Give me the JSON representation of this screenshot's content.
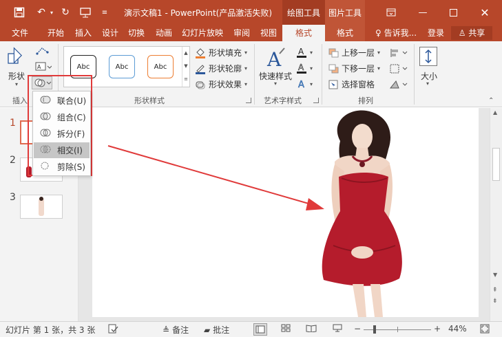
{
  "titlebar": {
    "title": "演示文稿1 - PowerPoint(产品激活失败)",
    "context_drawing": "绘图工具",
    "context_picture": "图片工具"
  },
  "tabs": [
    {
      "label": "文件"
    },
    {
      "label": "开始"
    },
    {
      "label": "插入"
    },
    {
      "label": "设计"
    },
    {
      "label": "切换"
    },
    {
      "label": "动画"
    },
    {
      "label": "幻灯片放映"
    },
    {
      "label": "审阅"
    },
    {
      "label": "视图"
    },
    {
      "label": "格式"
    },
    {
      "label": "格式"
    }
  ],
  "tell_me": "告诉我...",
  "login": "登录",
  "share": "共享",
  "ribbon": {
    "shapes_label": "形状",
    "insert_label": "插入",
    "gallery_samples": [
      "Abc",
      "Abc",
      "Abc"
    ],
    "fill": "形状填充",
    "outline": "形状轮廓",
    "effects": "形状效果",
    "shape_styles": "形状样式",
    "quick_styles": "快速样式",
    "wordart_styles": "艺术字样式",
    "bring_forward": "上移一层",
    "send_backward": "下移一层",
    "selection_pane": "选择窗格",
    "arrange": "排列",
    "size": "大小"
  },
  "merge_menu": {
    "items": [
      {
        "label": "联合(U)",
        "icon": "union-icon"
      },
      {
        "label": "组合(C)",
        "icon": "combine-icon"
      },
      {
        "label": "拆分(F)",
        "icon": "fragment-icon"
      },
      {
        "label": "相交(I)",
        "icon": "intersect-icon",
        "highlighted": true
      },
      {
        "label": "剪除(S)",
        "icon": "subtract-icon"
      }
    ]
  },
  "slides": [
    {
      "number": "1",
      "selected": true
    },
    {
      "number": "2"
    },
    {
      "number": "3"
    }
  ],
  "status": {
    "slide_info": "幻灯片 第 1 张，共 3 张",
    "notes": "备注",
    "comments": "批注",
    "zoom": "44%"
  },
  "colors": {
    "accent": "#b7472a",
    "annotation": "#e03a3a",
    "dress": "#b51c2c"
  }
}
